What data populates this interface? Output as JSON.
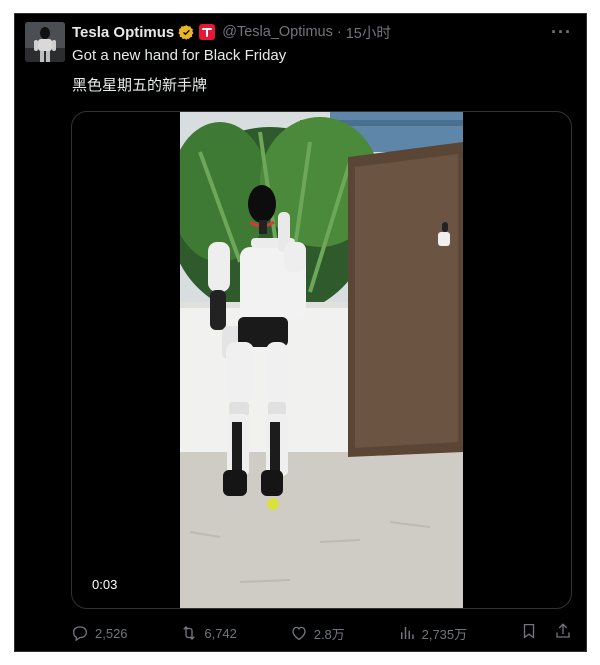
{
  "author": {
    "name": "Tesla Optimus",
    "handle": "@Tesla_Optimus",
    "separator": "·",
    "time": "15小时",
    "verified_color": "#e8b729",
    "affiliate_color": "#e31937"
  },
  "tweet": {
    "text_en": "Got a new hand for Black Friday",
    "text_zh": "黑色星期五的新手牌"
  },
  "media": {
    "duration": "0:03"
  },
  "actions": {
    "replies": "2,526",
    "reposts": "6,742",
    "likes": "2.8万",
    "views": "2,735万"
  },
  "icons": [
    "more-icon",
    "verified-badge-icon",
    "tesla-affiliate-icon",
    "reply-icon",
    "repost-icon",
    "like-icon",
    "views-icon",
    "bookmark-icon",
    "share-icon"
  ],
  "colors": {
    "background": "#000000",
    "text": "#e7e9ea",
    "muted": "#71767b",
    "border": "#2f3336"
  }
}
